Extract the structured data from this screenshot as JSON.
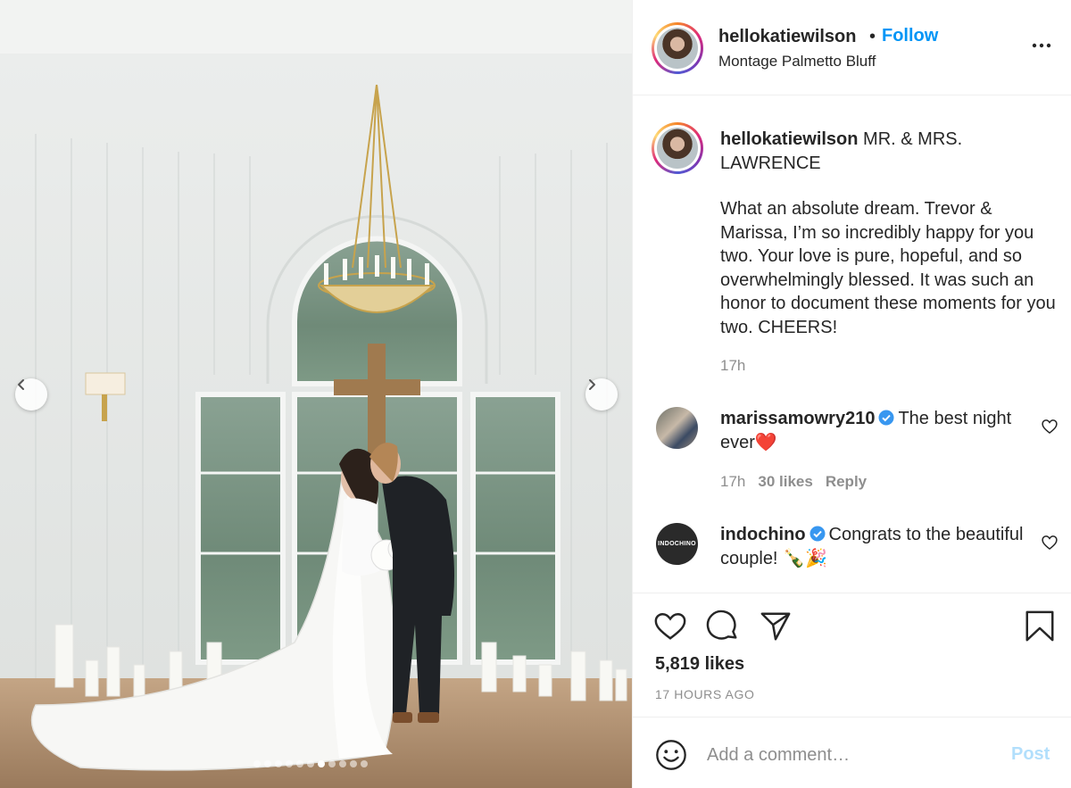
{
  "post": {
    "author": {
      "username": "hellokatiewilson",
      "separator": "•",
      "follow_label": "Follow",
      "location": "Montage Palmetto Bluff",
      "more_icon": "more-horizontal-icon"
    },
    "caption": {
      "username": "hellokatiewilson",
      "headline": "MR. & MRS. LAWRENCE",
      "body": "What an absolute dream. Trevor & Marissa, I’m so incredibly happy for you two. Your love is pure, hopeful, and so overwhelmingly blessed. It was such an honor to document these moments for you two. CHEERS!",
      "time": "17h"
    },
    "comments": [
      {
        "username": "marissamowry210",
        "verified": true,
        "text": "The best night ever❤️",
        "time": "17h",
        "likes": "30 likes",
        "reply_label": "Reply"
      },
      {
        "username": "indochino",
        "verified": true,
        "avatar_text": "INDOCHINO",
        "text": "Congrats to the beautiful couple! 🍾🎉"
      }
    ],
    "likes": "5,819 likes",
    "date": "17 HOURS AGO",
    "media": {
      "slide_count": 11,
      "active_slide": 7,
      "prev_icon": "chevron-left-icon",
      "next_icon": "chevron-right-icon"
    }
  },
  "composer": {
    "placeholder": "Add a comment…",
    "post_label": "Post"
  },
  "colors": {
    "accent": "#0095f6",
    "post_disabled": "#b2dffc",
    "text": "#262626",
    "muted": "#8e8e8e",
    "verified": "#3897f0"
  }
}
